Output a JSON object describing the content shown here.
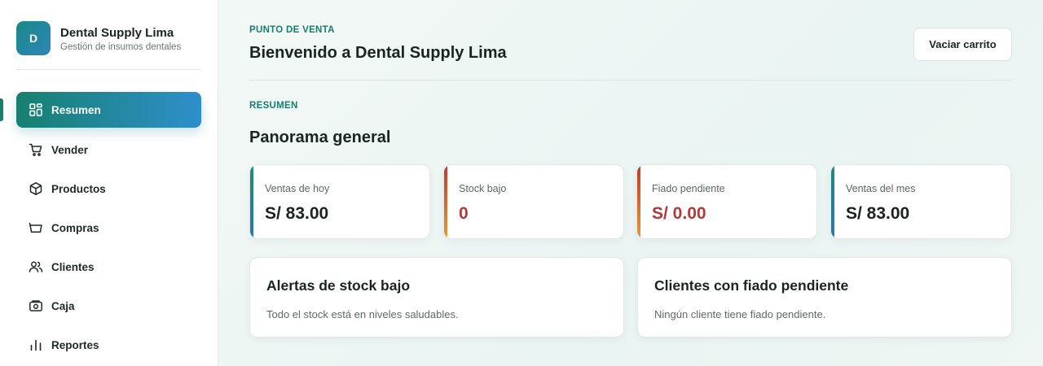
{
  "brand": {
    "logo_letter": "D",
    "name": "Dental Supply Lima",
    "subtitle": "Gestión de insumos dentales"
  },
  "nav": {
    "items": [
      {
        "label": "Resumen",
        "icon": "dashboard-icon",
        "active": true
      },
      {
        "label": "Vender",
        "icon": "cart-icon"
      },
      {
        "label": "Productos",
        "icon": "box-icon"
      },
      {
        "label": "Compras",
        "icon": "basket-icon"
      },
      {
        "label": "Clientes",
        "icon": "users-icon"
      },
      {
        "label": "Caja",
        "icon": "cash-register-icon"
      },
      {
        "label": "Reportes",
        "icon": "bar-chart-icon"
      }
    ]
  },
  "header": {
    "eyebrow": "PUNTO DE VENTA",
    "title": "Bienvenido a Dental Supply Lima",
    "clear_cart_label": "Vaciar carrito"
  },
  "overview": {
    "section_label": "RESUMEN",
    "title": "Panorama general",
    "stats": [
      {
        "label": "Ventas de hoy",
        "value": "S/ 83.00"
      },
      {
        "label": "Stock bajo",
        "value": "0"
      },
      {
        "label": "Fiado pendiente",
        "value": "S/ 0.00"
      },
      {
        "label": "Ventas del mes",
        "value": "S/ 83.00"
      }
    ]
  },
  "panels": {
    "low_stock": {
      "title": "Alertas de stock bajo",
      "text": "Todo el stock está en niveles saludables."
    },
    "credit_clients": {
      "title": "Clientes con fiado pendiente",
      "text": "Ningún cliente tiene fiado pendiente."
    }
  },
  "colors": {
    "brand_accent": "#17806a",
    "teal_accent": "#1f8aa0",
    "warning_accent": "#d4743a",
    "danger_value": "#b33a3a"
  }
}
